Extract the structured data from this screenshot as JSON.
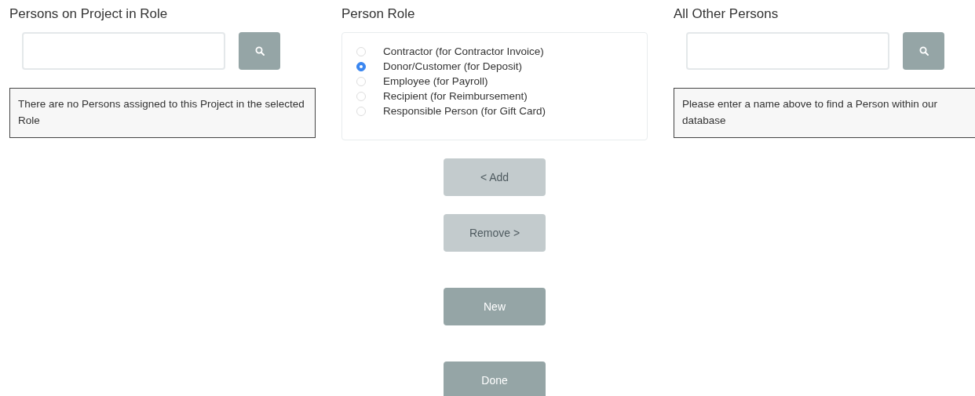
{
  "left_panel": {
    "title": "Persons on Project in Role",
    "message": "There are no Persons assigned to this Project in the selected Role"
  },
  "role_panel": {
    "title": "Person Role",
    "options": [
      {
        "label": "Contractor (for Contractor Invoice)",
        "selected": false
      },
      {
        "label": "Donor/Customer (for Deposit)",
        "selected": true
      },
      {
        "label": "Employee (for Payroll)",
        "selected": false
      },
      {
        "label": "Recipient (for Reimbursement)",
        "selected": false
      },
      {
        "label": "Responsible Person (for Gift Card)",
        "selected": false
      }
    ]
  },
  "buttons": [
    {
      "label": "< Add",
      "disabled": true
    },
    {
      "label": "Remove >",
      "disabled": true
    },
    {
      "label": "New",
      "disabled": false
    },
    {
      "label": "Done",
      "disabled": false
    }
  ],
  "right_panel": {
    "title": "All Other Persons",
    "message": "Please enter a name above to find a Person within our database"
  }
}
